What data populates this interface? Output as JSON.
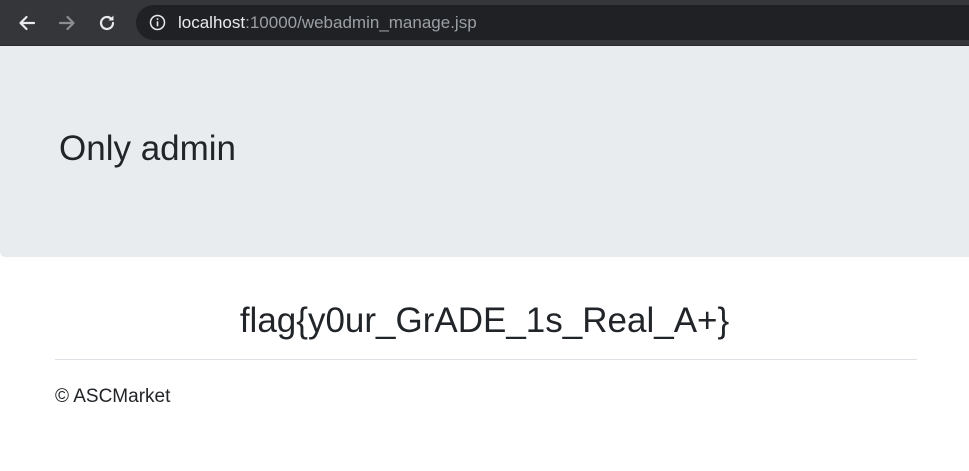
{
  "browser": {
    "url_host": "localhost",
    "url_path": ":10000/webadmin_manage.jsp",
    "icons": {
      "back": "back-arrow-icon",
      "forward": "forward-arrow-icon",
      "reload": "reload-icon",
      "site_info": "info-icon"
    },
    "colors": {
      "toolbar": "#35363a",
      "omnibox": "#202124"
    }
  },
  "page": {
    "jumbotron_title": "Only admin",
    "flag": "flag{y0ur_GrADE_1s_Real_A+}",
    "footer": "© ASCMarket",
    "colors": {
      "jumbotron_bg": "#e9ecef",
      "text": "#212529",
      "divider": "#dee2e6"
    }
  }
}
